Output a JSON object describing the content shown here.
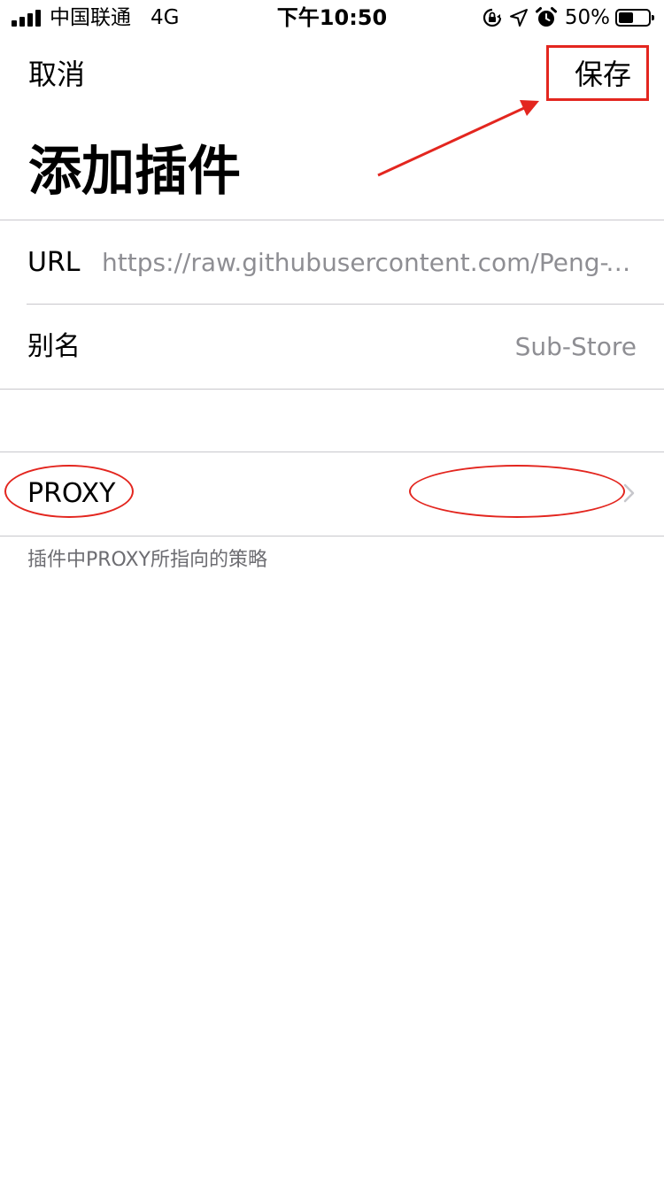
{
  "status_bar": {
    "carrier": "中国联通",
    "network": "4G",
    "time": "下午10:50",
    "battery_percent": "50%",
    "battery_level": 0.5,
    "icons": [
      "signal-icon",
      "orientation-lock-icon",
      "location-icon",
      "alarm-icon",
      "battery-icon"
    ]
  },
  "nav": {
    "cancel_label": "取消",
    "save_label": "保存"
  },
  "page": {
    "title": "添加插件"
  },
  "form": {
    "url": {
      "label": "URL",
      "value": "https://raw.githubusercontent.com/Peng-YM/Sub-Store/master/config/QX.snippet"
    },
    "alias": {
      "label": "别名",
      "value": "Sub-Store"
    },
    "proxy": {
      "label": "PROXY",
      "value": "",
      "footnote": "插件中PROXY所指向的策略"
    }
  },
  "annotations": {
    "color": "#e3261f"
  },
  "colors": {
    "separator": "#c8c7cc",
    "placeholder_text": "#8e8e93",
    "footnote_text": "#6d6d72"
  }
}
